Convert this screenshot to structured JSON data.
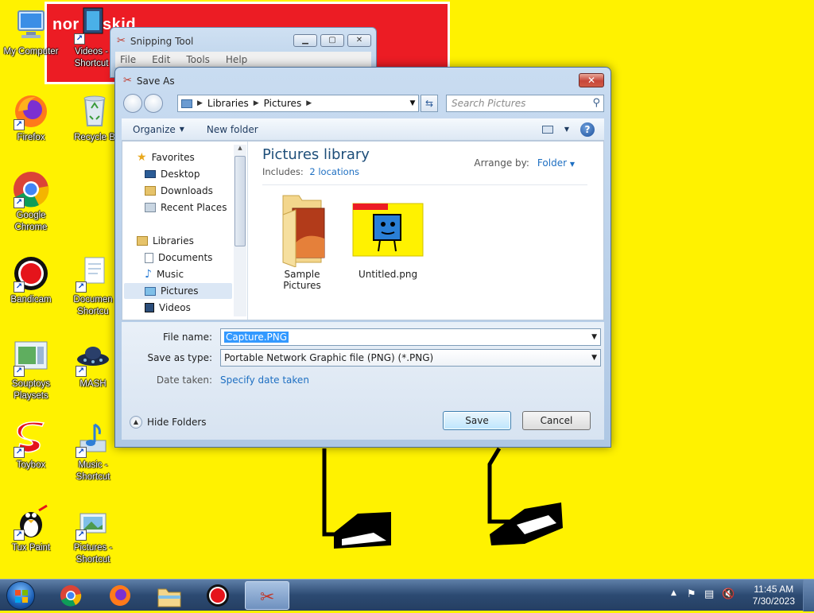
{
  "desktop": {
    "banner_text": "nor    a9skid",
    "icons": [
      {
        "label": "My Computer"
      },
      {
        "label": "Videos -\nShortcut"
      },
      {
        "label": "Firefox"
      },
      {
        "label": "Recycle B"
      },
      {
        "label": "Google\nChrome"
      },
      {
        "label": "Bandicam"
      },
      {
        "label": "Documen\nShortcu"
      },
      {
        "label": "Souptoys\nPlaysets"
      },
      {
        "label": "MASH"
      },
      {
        "label": "Toybox"
      },
      {
        "label": "Music -\nShortcut"
      },
      {
        "label": "Tux Paint"
      },
      {
        "label": "Pictures -\nShortcut"
      }
    ]
  },
  "snipping_tool": {
    "title": "Snipping Tool",
    "menu": [
      "File",
      "Edit",
      "Tools",
      "Help"
    ]
  },
  "save_as": {
    "title": "Save As",
    "breadcrumb": [
      "Libraries",
      "Pictures"
    ],
    "search_placeholder": "Search Pictures",
    "toolbar": {
      "organize": "Organize",
      "new_folder": "New folder"
    },
    "nav": {
      "favorites": "Favorites",
      "favorites_items": [
        "Desktop",
        "Downloads",
        "Recent Places"
      ],
      "libraries": "Libraries",
      "libraries_items": [
        "Documents",
        "Music",
        "Pictures",
        "Videos"
      ]
    },
    "library": {
      "title": "Pictures library",
      "includes_label": "Includes:",
      "includes_link": "2 locations",
      "arrange_label": "Arrange by:",
      "arrange_value": "Folder"
    },
    "files": [
      {
        "name": "Sample Pictures",
        "type": "folder"
      },
      {
        "name": "Untitled.png",
        "type": "image"
      }
    ],
    "form": {
      "file_name_label": "File name:",
      "file_name_value": "Capture.PNG",
      "save_type_label": "Save as type:",
      "save_type_value": "Portable Network Graphic file (PNG) (*.PNG)",
      "date_taken_label": "Date taken:",
      "date_taken_link": "Specify date taken"
    },
    "hide_folders": "Hide Folders",
    "save_button": "Save",
    "cancel_button": "Cancel"
  },
  "taskbar": {
    "time": "11:45 AM",
    "date": "7/30/2023"
  },
  "colors": {
    "desktop_bg": "#fff200",
    "banner_red": "#ec1c24",
    "link_blue": "#1e6fc2",
    "selection_blue": "#3399ff"
  }
}
